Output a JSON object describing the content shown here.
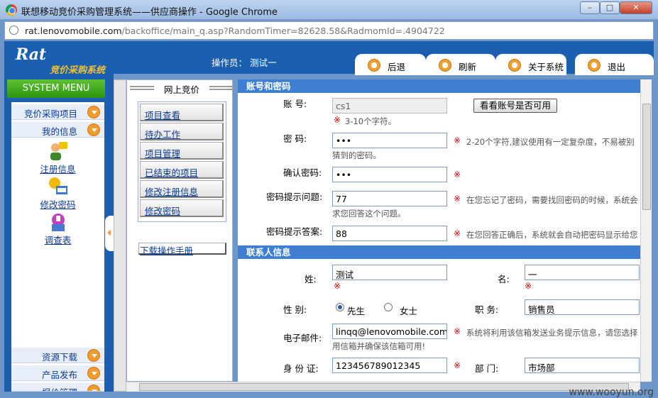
{
  "window": {
    "title": "联想移动竞价采购管理系统——供应商操作 - Google Chrome"
  },
  "address": {
    "host": "rat.lenovomobile.com",
    "path": "/backoffice/main_q.asp?RandomTimer=82628.58&RadmomId=.4904722"
  },
  "header": {
    "logo": "Rat",
    "logo_cn": "竞价采购系统",
    "operator": "操作员：   测试一",
    "tabs": [
      {
        "label": "后退",
        "icon": "back-icon"
      },
      {
        "label": "刷新",
        "icon": "refresh-icon"
      },
      {
        "label": "关于系统",
        "icon": "about-icon"
      },
      {
        "label": "退出",
        "icon": "exit-icon"
      }
    ]
  },
  "sidebar": {
    "title": "SYSTEM MENU",
    "items": [
      {
        "label": "竞价采购项目"
      },
      {
        "label": "我的信息"
      },
      {
        "label": "资源下载"
      },
      {
        "label": "产品发布"
      },
      {
        "label": "报价管理"
      }
    ],
    "subitems": [
      {
        "label": "注册信息",
        "icon": "user-icon"
      },
      {
        "label": "修改密码",
        "icon": "key-icon"
      },
      {
        "label": "调查表",
        "icon": "survey-icon"
      }
    ]
  },
  "mid": {
    "title": "网上竞价",
    "links": [
      {
        "label": "项目查看"
      },
      {
        "label": "待办工作"
      },
      {
        "label": "项目管理"
      },
      {
        "label": "已结束的项目"
      },
      {
        "label": "修改注册信息"
      },
      {
        "label": "修改密码"
      }
    ],
    "download": "下载操作手册"
  },
  "form": {
    "section_account": "账号和密码",
    "account_label": "账    号:",
    "account_value": "cs1",
    "check_button": "看看账号是否可用",
    "account_hint": "3-10个字符。",
    "pwd_label": "密    码:",
    "pwd_value": "•••",
    "pwd_hint1": "2-20个字符,建议使用有一定复杂度，不易被别",
    "pwd_hint2": "猜到的密码。",
    "confirm_label": "确认密码:",
    "confirm_value": "•••",
    "question_label": "密码提示问题:",
    "question_value": "77",
    "question_hint1": "在您忘记了密码，需要找回密码的时候，系统会",
    "question_hint2": "求您回答这个问题。",
    "answer_label": "密码提示答案:",
    "answer_value": "88",
    "answer_hint": "在您回答正确后，系统就会自动把密码显示给您",
    "section_contact": "联系人信息",
    "surname_label": "姓:",
    "surname_value": "测试",
    "name_label": "名:",
    "name_value": "一",
    "gender_label": "性    别:",
    "gender_male": "先生",
    "gender_female": "女士",
    "title_label": "职    务:",
    "title_value": "销售员",
    "email_label": "电子邮件:",
    "email_value": "linqq@lenovomobile.com",
    "email_hint1": "系统将利用该信箱发送业务提示信息，请您选择",
    "email_hint2": "用信箱并确保该信箱可用!",
    "id_label": "身 份 证:",
    "id_value": "123456789012345",
    "dept_label": "部    门:",
    "dept_value": "市场部",
    "star": "※"
  },
  "watermark": "www.wooyun.org"
}
